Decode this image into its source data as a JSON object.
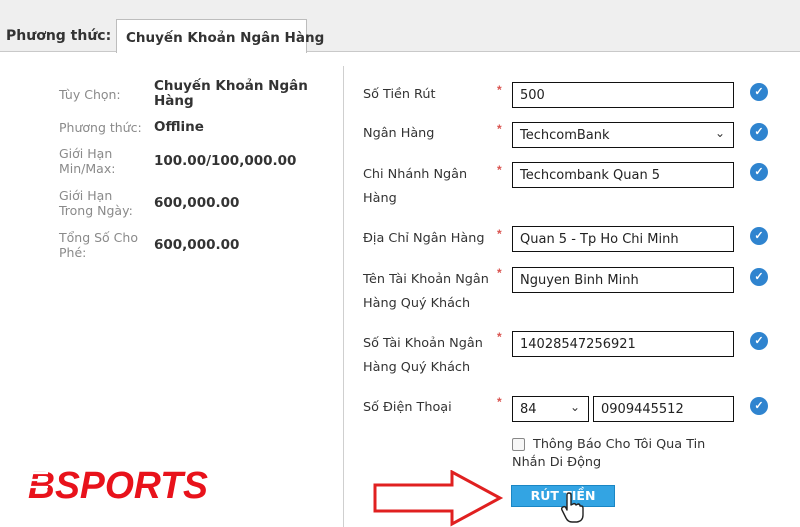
{
  "header": {
    "method_label": "Phương thức:",
    "active_tab": "Chuyến Khoản Ngân Hàng"
  },
  "info": [
    {
      "label_lines": [
        "Tùy Chọn:"
      ],
      "value_lines": [
        "Chuyến Khoản Ngân",
        "Hàng"
      ]
    },
    {
      "label_lines": [
        "Phương thức:"
      ],
      "value_lines": [
        "Offline"
      ]
    },
    {
      "label_lines": [
        "Giới Hạn",
        "Min/Max:"
      ],
      "value_lines": [
        "100.00/100,000.00"
      ]
    },
    {
      "label_lines": [
        "Giới Hạn",
        "Trong Ngày:"
      ],
      "value_lines": [
        "600,000.00"
      ]
    },
    {
      "label_lines": [
        "Tổng Số Cho",
        "Phé:"
      ],
      "value_lines": [
        "600,000.00"
      ]
    }
  ],
  "form": {
    "amount": {
      "label": "Số Tiền Rút",
      "value": "500"
    },
    "bank": {
      "label": "Ngân Hàng",
      "value": "TechcomBank"
    },
    "branch": {
      "label_lines": [
        "Chi Nhánh Ngân",
        "Hàng"
      ],
      "value": "Techcombank Quan 5"
    },
    "address": {
      "label": "Địa Chỉ Ngân Hàng",
      "value": "Quan 5 - Tp Ho Chi Minh"
    },
    "account_name": {
      "label_lines": [
        "Tên Tài Khoản Ngân",
        "Hàng Quý Khách"
      ],
      "value": "Nguyen Binh Minh"
    },
    "account_number": {
      "label_lines": [
        "Số Tài Khoản Ngân",
        "Hàng Quý Khách"
      ],
      "value": "14028547256921"
    },
    "phone": {
      "label": "Số Điện Thoại",
      "country_code": "84",
      "number": "0909445512"
    },
    "required_mark": "*",
    "valid_mark": "✓",
    "sms_opt_in": {
      "label": "Thông Báo Cho Tôi Qua Tin Nhắn Di Động",
      "checked": false
    },
    "submit_label": "RÚT TIỀN"
  },
  "logo": {
    "text": "BSPORTS",
    "color": "#e8121b"
  },
  "colors": {
    "check": "#2f84cf",
    "button": "#33a4e3",
    "required": "#d9534f",
    "arrow": "#e02020"
  }
}
